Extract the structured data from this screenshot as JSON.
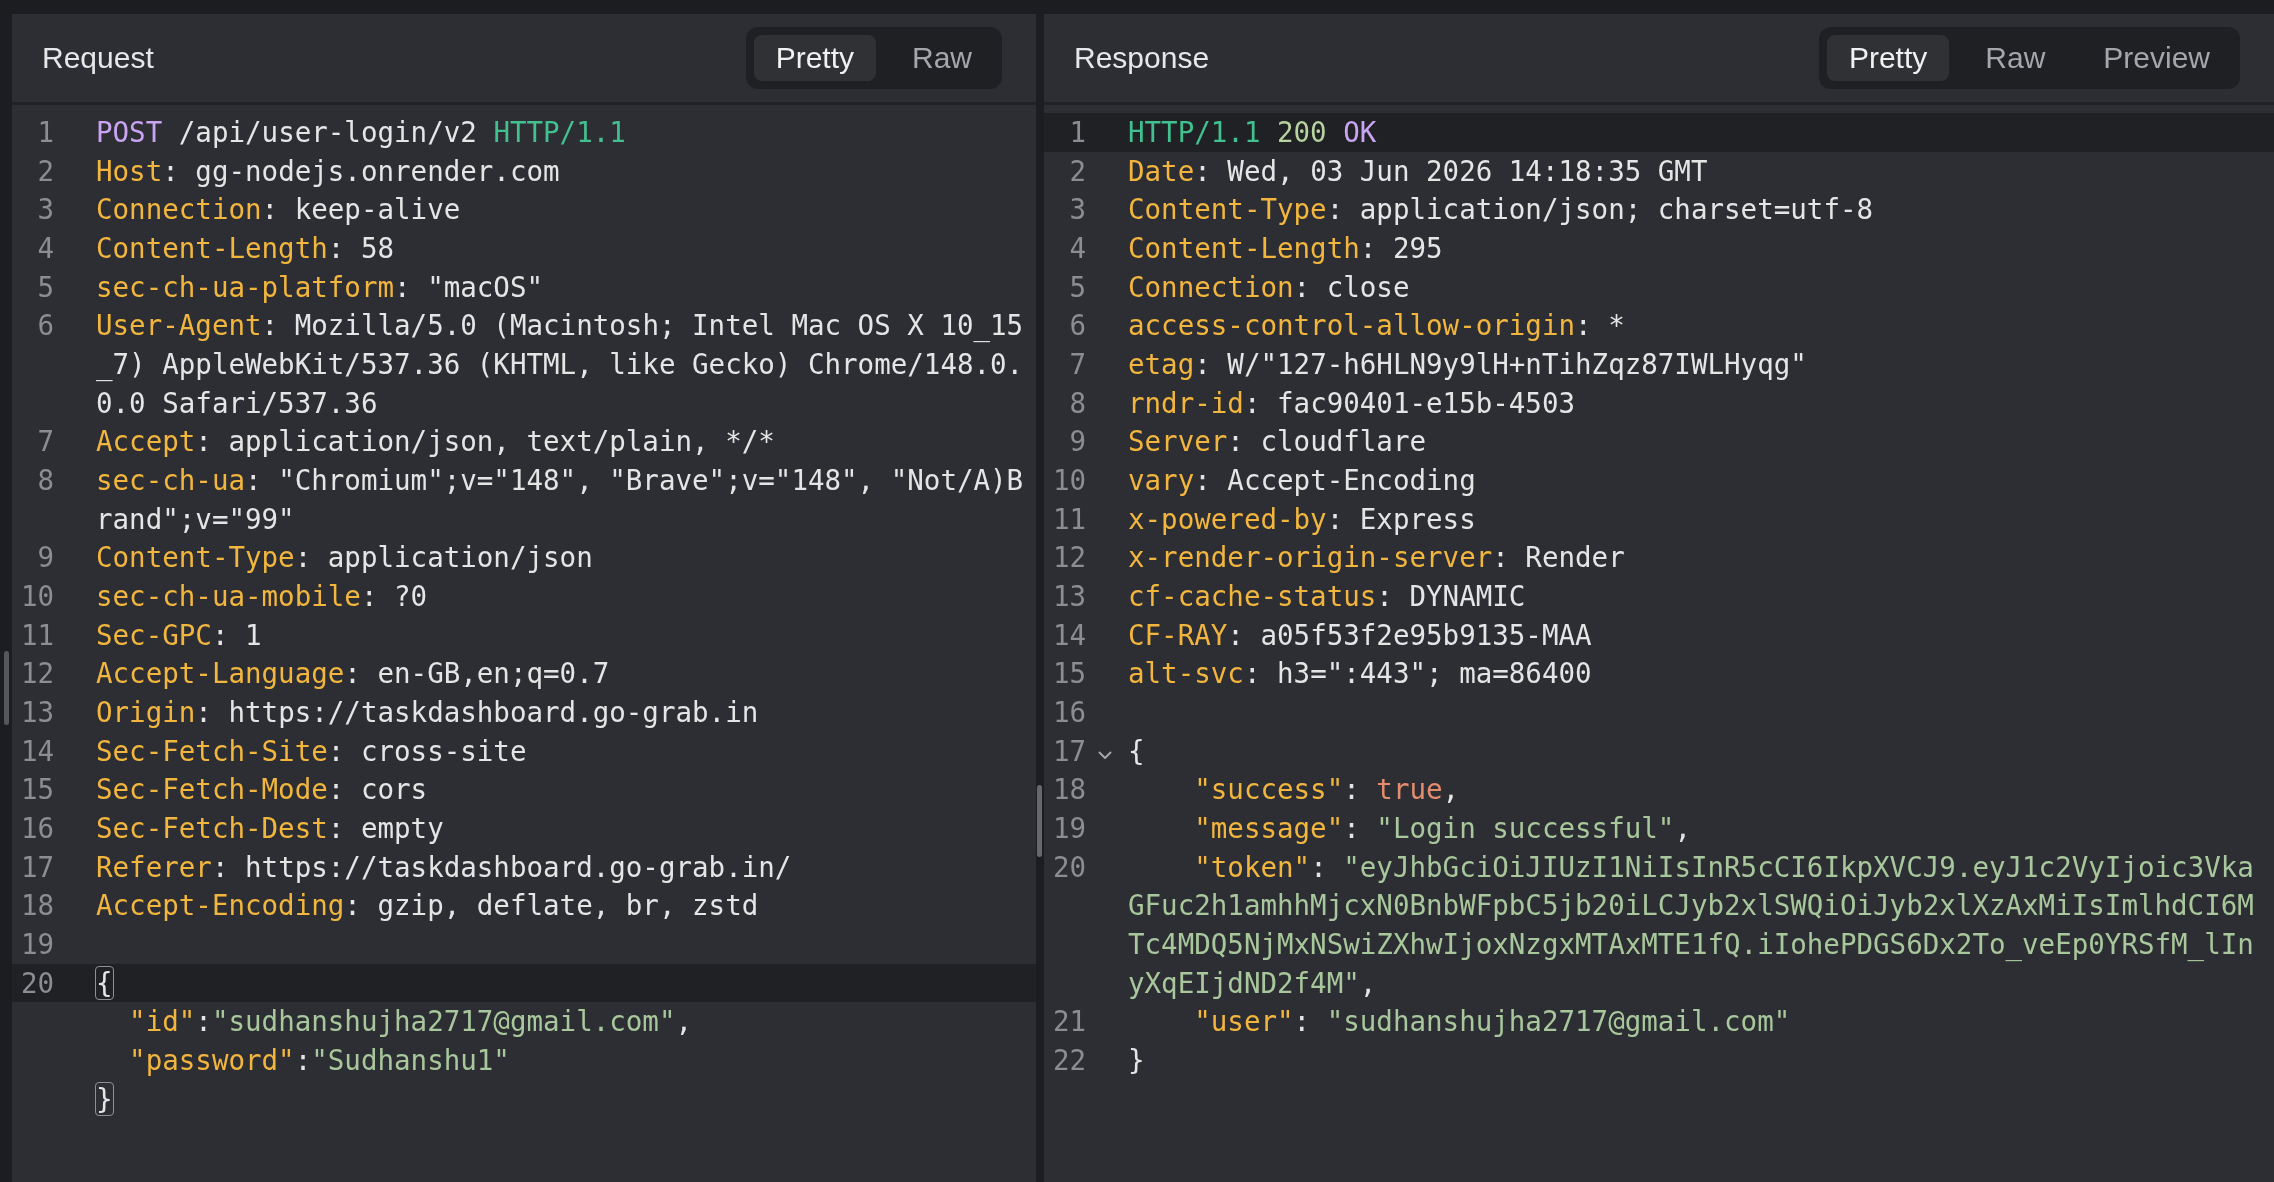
{
  "request": {
    "title": "Request",
    "tabs": [
      {
        "label": "Pretty",
        "selected": true
      },
      {
        "label": "Raw",
        "selected": false
      }
    ],
    "lines": [
      {
        "number": "1",
        "highlighted": false,
        "foldable": false,
        "tokens": [
          {
            "kind": "method",
            "text": "POST"
          },
          {
            "kind": "plain",
            "text": " /api/user-login/v2 "
          },
          {
            "kind": "protocol",
            "text": "HTTP/1.1"
          }
        ]
      },
      {
        "number": "2",
        "highlighted": false,
        "foldable": false,
        "tokens": [
          {
            "kind": "key",
            "text": "Host"
          },
          {
            "kind": "plain",
            "text": ": gg-nodejs.onrender.com"
          }
        ]
      },
      {
        "number": "3",
        "highlighted": false,
        "foldable": false,
        "tokens": [
          {
            "kind": "key",
            "text": "Connection"
          },
          {
            "kind": "plain",
            "text": ": keep-alive"
          }
        ]
      },
      {
        "number": "4",
        "highlighted": false,
        "foldable": false,
        "tokens": [
          {
            "kind": "key",
            "text": "Content-Length"
          },
          {
            "kind": "plain",
            "text": ": 58"
          }
        ]
      },
      {
        "number": "5",
        "highlighted": false,
        "foldable": false,
        "tokens": [
          {
            "kind": "key",
            "text": "sec-ch-ua-platform"
          },
          {
            "kind": "plain",
            "text": ": \"macOS\""
          }
        ]
      },
      {
        "number": "6",
        "highlighted": false,
        "foldable": false,
        "tokens": [
          {
            "kind": "key",
            "text": "User-Agent"
          },
          {
            "kind": "plain",
            "text": ": Mozilla/5.0 (Macintosh; Intel Mac OS X 10_15_7) AppleWebKit/537.36 (KHTML, like Gecko) Chrome/148.0.0.0 Safari/537.36"
          }
        ]
      },
      {
        "number": "7",
        "highlighted": false,
        "foldable": false,
        "tokens": [
          {
            "kind": "key",
            "text": "Accept"
          },
          {
            "kind": "plain",
            "text": ": application/json, text/plain, */*"
          }
        ]
      },
      {
        "number": "8",
        "highlighted": false,
        "foldable": false,
        "tokens": [
          {
            "kind": "key",
            "text": "sec-ch-ua"
          },
          {
            "kind": "plain",
            "text": ": \"Chromium\";v=\"148\", \"Brave\";v=\"148\", \"Not/A)Brand\";v=\"99\""
          }
        ]
      },
      {
        "number": "9",
        "highlighted": false,
        "foldable": false,
        "tokens": [
          {
            "kind": "key",
            "text": "Content-Type"
          },
          {
            "kind": "plain",
            "text": ": application/json"
          }
        ]
      },
      {
        "number": "10",
        "highlighted": false,
        "foldable": false,
        "tokens": [
          {
            "kind": "key",
            "text": "sec-ch-ua-mobile"
          },
          {
            "kind": "plain",
            "text": ": ?0"
          }
        ]
      },
      {
        "number": "11",
        "highlighted": false,
        "foldable": false,
        "tokens": [
          {
            "kind": "key",
            "text": "Sec-GPC"
          },
          {
            "kind": "plain",
            "text": ": 1"
          }
        ]
      },
      {
        "number": "12",
        "highlighted": false,
        "foldable": false,
        "tokens": [
          {
            "kind": "key",
            "text": "Accept-Language"
          },
          {
            "kind": "plain",
            "text": ": en-GB,en;q=0.7"
          }
        ]
      },
      {
        "number": "13",
        "highlighted": false,
        "foldable": false,
        "tokens": [
          {
            "kind": "key",
            "text": "Origin"
          },
          {
            "kind": "plain",
            "text": ": https://taskdashboard.go-grab.in"
          }
        ]
      },
      {
        "number": "14",
        "highlighted": false,
        "foldable": false,
        "tokens": [
          {
            "kind": "key",
            "text": "Sec-Fetch-Site"
          },
          {
            "kind": "plain",
            "text": ": cross-site"
          }
        ]
      },
      {
        "number": "15",
        "highlighted": false,
        "foldable": false,
        "tokens": [
          {
            "kind": "key",
            "text": "Sec-Fetch-Mode"
          },
          {
            "kind": "plain",
            "text": ": cors"
          }
        ]
      },
      {
        "number": "16",
        "highlighted": false,
        "foldable": false,
        "tokens": [
          {
            "kind": "key",
            "text": "Sec-Fetch-Dest"
          },
          {
            "kind": "plain",
            "text": ": empty"
          }
        ]
      },
      {
        "number": "17",
        "highlighted": false,
        "foldable": false,
        "tokens": [
          {
            "kind": "key",
            "text": "Referer"
          },
          {
            "kind": "plain",
            "text": ": https://taskdashboard.go-grab.in/"
          }
        ]
      },
      {
        "number": "18",
        "highlighted": false,
        "foldable": false,
        "tokens": [
          {
            "kind": "key",
            "text": "Accept-Encoding"
          },
          {
            "kind": "plain",
            "text": ": gzip, deflate, br, zstd"
          }
        ]
      },
      {
        "number": "19",
        "highlighted": false,
        "foldable": false
      },
      {
        "number": "20",
        "highlighted": true,
        "foldable": false,
        "tokens": [
          {
            "kind": "matched-bracket",
            "text": "{"
          }
        ],
        "children": [
          {
            "highlighted": false,
            "foldable": false,
            "tokens": [
              {
                "kind": "key",
                "text": "\"id\""
              },
              {
                "kind": "plain",
                "text": ":"
              },
              {
                "kind": "string",
                "text": "\"sudhanshujha2717@gmail.com\""
              },
              {
                "kind": "plain",
                "text": ","
              }
            ]
          },
          {
            "highlighted": false,
            "foldable": false,
            "tokens": [
              {
                "kind": "key",
                "text": "\"password\""
              },
              {
                "kind": "plain",
                "text": ":"
              },
              {
                "kind": "string",
                "text": "\"Sudhanshu1\""
              }
            ]
          }
        ]
      },
      {
        "highlighted": false,
        "foldable": false,
        "tokens": [
          {
            "kind": "matched-bracket",
            "text": "}"
          }
        ]
      }
    ]
  },
  "response": {
    "title": "Response",
    "tabs": [
      {
        "label": "Pretty",
        "selected": true
      },
      {
        "label": "Raw",
        "selected": false
      },
      {
        "label": "Preview",
        "selected": false
      }
    ],
    "lines": [
      {
        "number": "1",
        "highlighted": true,
        "foldable": false,
        "tokens": [
          {
            "kind": "protocol",
            "text": "HTTP/1.1"
          },
          {
            "kind": "status-code",
            "text": " 200"
          },
          {
            "kind": "status-text",
            "text": " OK"
          }
        ]
      },
      {
        "number": "2",
        "highlighted": false,
        "foldable": false,
        "tokens": [
          {
            "kind": "key",
            "text": "Date"
          },
          {
            "kind": "plain",
            "text": ": Wed, 03 Jun 2026 14:18:35 GMT"
          }
        ]
      },
      {
        "number": "3",
        "highlighted": false,
        "foldable": false,
        "tokens": [
          {
            "kind": "key",
            "text": "Content-Type"
          },
          {
            "kind": "plain",
            "text": ": application/json; charset=utf-8"
          }
        ]
      },
      {
        "number": "4",
        "highlighted": false,
        "foldable": false,
        "tokens": [
          {
            "kind": "key",
            "text": "Content-Length"
          },
          {
            "kind": "plain",
            "text": ": 295"
          }
        ]
      },
      {
        "number": "5",
        "highlighted": false,
        "foldable": false,
        "tokens": [
          {
            "kind": "key",
            "text": "Connection"
          },
          {
            "kind": "plain",
            "text": ": close"
          }
        ]
      },
      {
        "number": "6",
        "highlighted": false,
        "foldable": false,
        "tokens": [
          {
            "kind": "key",
            "text": "access-control-allow-origin"
          },
          {
            "kind": "plain",
            "text": ": *"
          }
        ]
      },
      {
        "number": "7",
        "highlighted": false,
        "foldable": false,
        "tokens": [
          {
            "kind": "key",
            "text": "etag"
          },
          {
            "kind": "plain",
            "text": ": W/\"127-h6HLN9y9lH+nTihZqz87IWLHyqg\""
          }
        ]
      },
      {
        "number": "8",
        "highlighted": false,
        "foldable": false,
        "tokens": [
          {
            "kind": "key",
            "text": "rndr-id"
          },
          {
            "kind": "plain",
            "text": ": fac90401-e15b-4503"
          }
        ]
      },
      {
        "number": "9",
        "highlighted": false,
        "foldable": false,
        "tokens": [
          {
            "kind": "key",
            "text": "Server"
          },
          {
            "kind": "plain",
            "text": ": cloudflare"
          }
        ]
      },
      {
        "number": "10",
        "highlighted": false,
        "foldable": false,
        "tokens": [
          {
            "kind": "key",
            "text": "vary"
          },
          {
            "kind": "plain",
            "text": ": Accept-Encoding"
          }
        ]
      },
      {
        "number": "11",
        "highlighted": false,
        "foldable": false,
        "tokens": [
          {
            "kind": "key",
            "text": "x-powered-by"
          },
          {
            "kind": "plain",
            "text": ": Express"
          }
        ]
      },
      {
        "number": "12",
        "highlighted": false,
        "foldable": false,
        "tokens": [
          {
            "kind": "key",
            "text": "x-render-origin-server"
          },
          {
            "kind": "plain",
            "text": ": Render"
          }
        ]
      },
      {
        "number": "13",
        "highlighted": false,
        "foldable": false,
        "tokens": [
          {
            "kind": "key",
            "text": "cf-cache-status"
          },
          {
            "kind": "plain",
            "text": ": DYNAMIC"
          }
        ]
      },
      {
        "number": "14",
        "highlighted": false,
        "foldable": false,
        "tokens": [
          {
            "kind": "key",
            "text": "CF-RAY"
          },
          {
            "kind": "plain",
            "text": ": a05f53f2e95b9135-MAA"
          }
        ]
      },
      {
        "number": "15",
        "highlighted": false,
        "foldable": false,
        "tokens": [
          {
            "kind": "key",
            "text": "alt-svc"
          },
          {
            "kind": "plain",
            "text": ": h3=\":443\"; ma=86400"
          }
        ]
      },
      {
        "number": "16",
        "highlighted": false,
        "foldable": false
      },
      {
        "number": "17",
        "highlighted": false,
        "foldable": true,
        "tokens": [
          {
            "kind": "plain",
            "text": "{"
          }
        ],
        "children": [
          {
            "number": "18",
            "highlighted": false,
            "foldable": false,
            "tokens": [
              {
                "kind": "key",
                "text": "\"success\""
              },
              {
                "kind": "plain",
                "text": ": "
              },
              {
                "kind": "boolean",
                "text": "true"
              },
              {
                "kind": "plain",
                "text": ","
              }
            ]
          },
          {
            "number": "19",
            "highlighted": false,
            "foldable": false,
            "tokens": [
              {
                "kind": "key",
                "text": "\"message\""
              },
              {
                "kind": "plain",
                "text": ": "
              },
              {
                "kind": "string",
                "text": "\"Login successful\""
              },
              {
                "kind": "plain",
                "text": ","
              }
            ]
          },
          {
            "number": "20",
            "highlighted": false,
            "foldable": false,
            "tokens": [
              {
                "kind": "key",
                "text": "\"token\""
              },
              {
                "kind": "plain",
                "text": ": "
              },
              {
                "kind": "string",
                "text": "\"eyJhbGciOiJIUzI1NiIsInR5cCI6IkpXVCJ9.eyJ1c2VyIjoic3VkaGFuc2h1amhhMjcxN0BnbWFpbC5jb20iLCJyb2xlSWQiOiJyb2xlXzAxMiIsImlhdCI6MTc4MDQ5NjMxNSwiZXhwIjoxNzgxMTAxMTE1fQ.iIohePDGS6Dx2To_veEp0YRSfM_lInyXqEIjdND2f4M\""
              },
              {
                "kind": "plain",
                "text": ","
              }
            ]
          },
          {
            "number": "21",
            "highlighted": false,
            "foldable": false,
            "tokens": [
              {
                "kind": "key",
                "text": "\"user\""
              },
              {
                "kind": "plain",
                "text": ": "
              },
              {
                "kind": "string",
                "text": "\"sudhanshujha2717@gmail.com\""
              }
            ]
          }
        ]
      },
      {
        "number": "22",
        "highlighted": false,
        "foldable": false,
        "tokens": [
          {
            "kind": "plain",
            "text": "}"
          }
        ]
      }
    ]
  }
}
